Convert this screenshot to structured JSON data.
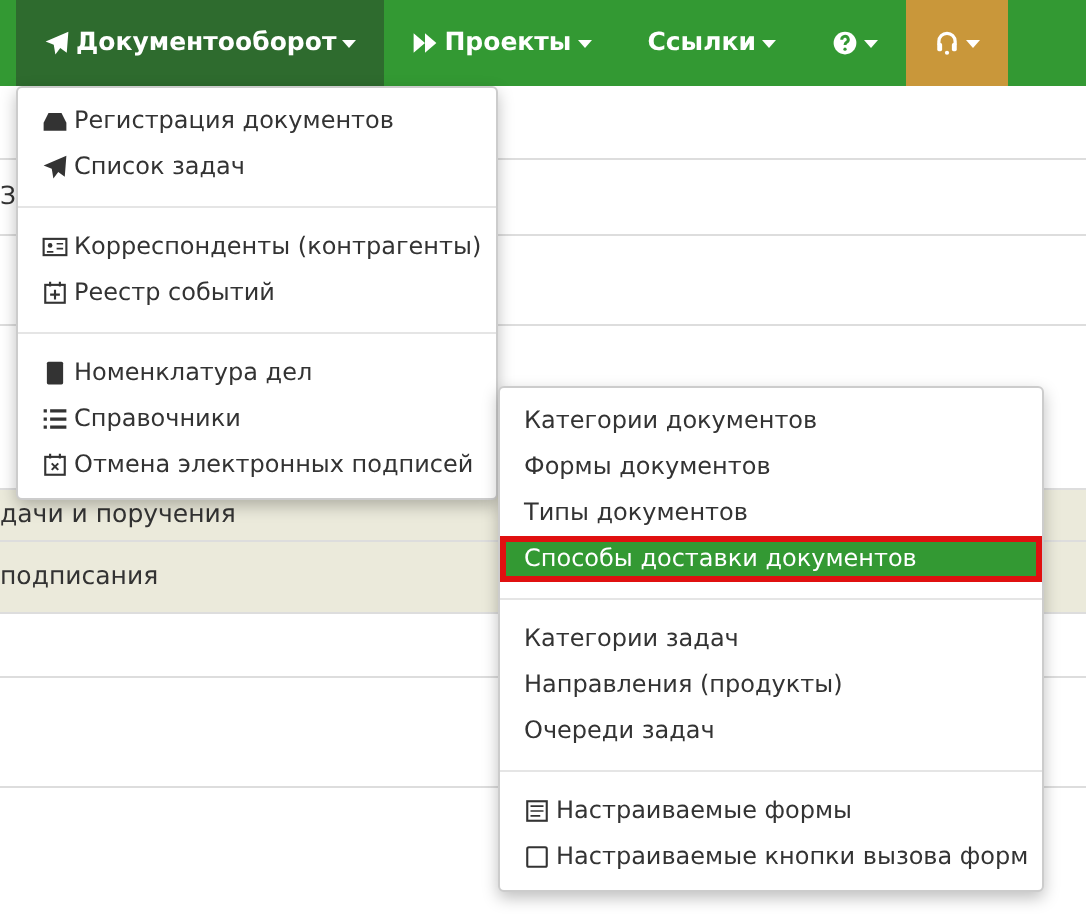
{
  "navbar": {
    "items": [
      {
        "label": "Документооборот",
        "selected": true,
        "kind": "text"
      },
      {
        "label": "Проекты",
        "selected": false,
        "kind": "text"
      },
      {
        "label": "Ссылки",
        "selected": false,
        "kind": "text"
      },
      {
        "selected": false,
        "kind": "icon"
      },
      {
        "selected": false,
        "kind": "highlight"
      }
    ]
  },
  "background_rows": [
    {
      "shaded": false
    },
    {
      "text": "З",
      "shaded": false
    },
    {
      "shaded": false
    },
    {
      "shaded": false
    },
    {
      "text": "дачи и поручения",
      "shaded": true
    },
    {
      "text": "подписания",
      "shaded": true
    },
    {
      "shaded": false
    },
    {
      "shaded": false
    }
  ],
  "main_menu": {
    "groups": [
      [
        {
          "label": "Регистрация документов"
        },
        {
          "label": "Список задач"
        }
      ],
      [
        {
          "label": "Корреспонденты (контрагенты)"
        },
        {
          "label": "Реестр событий"
        }
      ],
      [
        {
          "label": "Номенклатура дел"
        },
        {
          "label": "Справочники"
        },
        {
          "label": "Отмена электронных подписей"
        }
      ]
    ]
  },
  "submenu": {
    "groups": [
      [
        {
          "label": "Категории документов",
          "selected": false
        },
        {
          "label": "Формы документов",
          "selected": false
        },
        {
          "label": "Типы документов",
          "selected": false
        },
        {
          "label": "Способы доставки документов",
          "selected": true
        }
      ],
      [
        {
          "label": "Категории задач",
          "selected": false
        },
        {
          "label": "Направления (продукты)",
          "selected": false
        },
        {
          "label": "Очереди задач",
          "selected": false
        }
      ],
      [
        {
          "label": "Настраиваемые формы",
          "selected": false
        },
        {
          "label": "Настраиваемые кнопки вызова форм",
          "selected": false
        }
      ]
    ]
  }
}
